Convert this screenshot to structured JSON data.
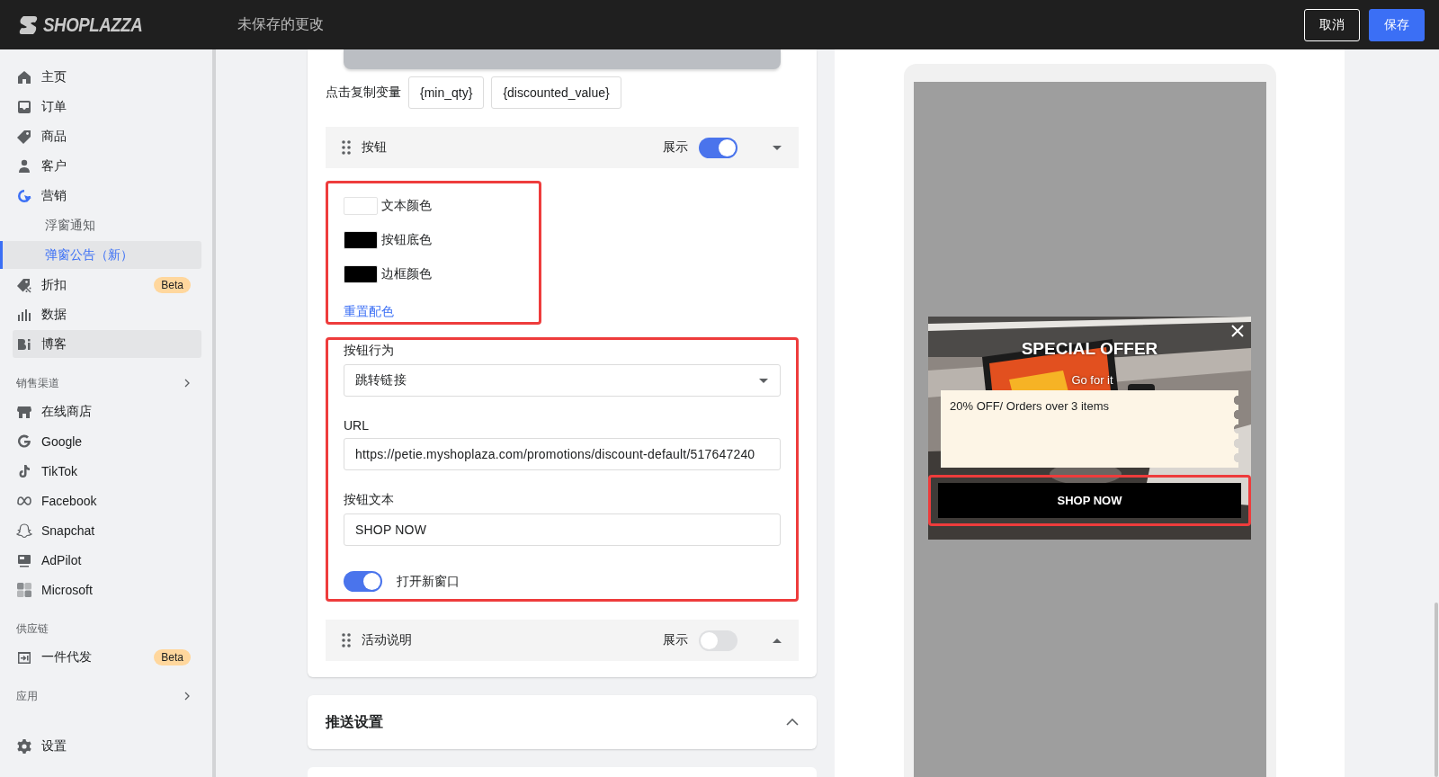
{
  "header": {
    "logo": "SHOPLAZZA",
    "title": "未保存的更改",
    "buttons": [
      {
        "label": "取消",
        "kind": "secondary"
      },
      {
        "label": "保存",
        "kind": "primary"
      }
    ]
  },
  "sidebar": {
    "groups": [
      {
        "items": [
          {
            "kind": "home",
            "label": "主页",
            "selected": false,
            "hovered": false
          },
          {
            "kind": "orders",
            "label": "订单",
            "selected": false,
            "hovered": false
          },
          {
            "kind": "products",
            "label": "商品",
            "selected": false,
            "hovered": false
          },
          {
            "kind": "customers",
            "label": "客户",
            "selected": false,
            "hovered": false
          },
          {
            "kind": "marketing",
            "label": "营销",
            "selected": false,
            "hovered": false,
            "children": [
              {
                "label": "浮窗通知",
                "selected": false
              },
              {
                "label": "弹窗公告（新）",
                "selected": true
              }
            ]
          },
          {
            "kind": "discount",
            "label": "折扣",
            "selected": false,
            "hovered": false,
            "badge": "Beta"
          },
          {
            "kind": "data",
            "label": "数据",
            "selected": false,
            "hovered": false
          },
          {
            "kind": "blog",
            "label": "博客",
            "selected": false,
            "hovered": true
          }
        ]
      },
      {
        "title": "销售渠道",
        "collapsible": true,
        "items": [
          {
            "kind": "store",
            "label": "在线商店",
            "selected": false,
            "hovered": false
          },
          {
            "kind": "google",
            "label": "Google",
            "selected": false,
            "hovered": false
          },
          {
            "kind": "tiktok",
            "label": "TikTok",
            "selected": false,
            "hovered": false
          },
          {
            "kind": "meta",
            "label": "Facebook",
            "selected": false,
            "hovered": false
          },
          {
            "kind": "snapchat",
            "label": "Snapchat",
            "selected": false,
            "hovered": false
          },
          {
            "kind": "adpilot",
            "label": "AdPilot",
            "selected": false,
            "hovered": false
          },
          {
            "kind": "microsoft",
            "label": "Microsoft",
            "selected": false,
            "hovered": false
          }
        ]
      },
      {
        "title": "供应链",
        "items": [
          {
            "kind": "dropship",
            "label": "一件代发",
            "selected": false,
            "hovered": false,
            "badge": "Beta"
          }
        ]
      },
      {
        "title": "应用",
        "collapsible": true
      },
      {
        "items": [
          {
            "kind": "settings",
            "label": "设置",
            "selected": false,
            "hovered": false
          }
        ]
      }
    ]
  },
  "editor": {
    "variables_label": "点击复制变量",
    "variables": [
      "{min_qty}",
      "{discounted_value}"
    ],
    "sections": [
      {
        "title": "按钮",
        "show_label": "展示",
        "shown": true,
        "expanded": true,
        "colors": [
          {
            "label": "文本颜色",
            "color": "#ffffff"
          },
          {
            "label": "按钮底色",
            "color": "#000000"
          },
          {
            "label": "边框颜色",
            "color": "#000000"
          }
        ],
        "reset_link": "重置配色",
        "behavior_label": "按钮行为",
        "behavior": "跳转链接",
        "url_label": "URL",
        "url": "https://petie.myshoplaza.com/promotions/discount-default/517647240",
        "text_label": "按钮文本",
        "text": "SHOP NOW",
        "new_window": {
          "on": true,
          "label": "打开新窗口"
        }
      },
      {
        "title": "活动说明",
        "show_label": "展示",
        "shown": false,
        "expanded": false
      }
    ],
    "push_settings": {
      "title": "推送设置",
      "expanded": false
    }
  },
  "preview": {
    "title": "SPECIAL OFFER",
    "subtitle": "Go for it",
    "coupon": "20% OFF/ Orders over 3 items",
    "button": "SHOP NOW"
  }
}
